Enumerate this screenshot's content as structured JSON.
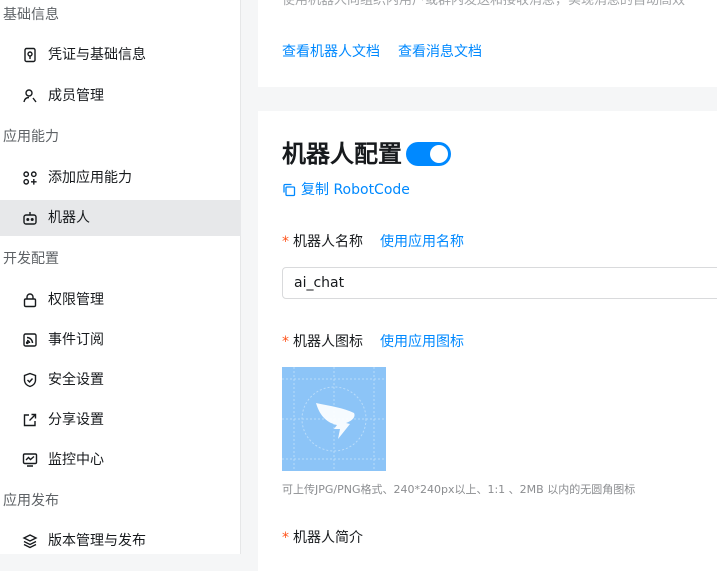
{
  "sidebar": {
    "groups": [
      {
        "title": "基础信息",
        "items": [
          {
            "label": "凭证与基础信息",
            "icon": "credential-icon"
          },
          {
            "label": "成员管理",
            "icon": "user-icon"
          }
        ]
      },
      {
        "title": "应用能力",
        "items": [
          {
            "label": "添加应用能力",
            "icon": "add-capability-icon"
          },
          {
            "label": "机器人",
            "icon": "robot-icon",
            "active": true
          }
        ]
      },
      {
        "title": "开发配置",
        "items": [
          {
            "label": "权限管理",
            "icon": "lock-icon"
          },
          {
            "label": "事件订阅",
            "icon": "subscription-icon"
          },
          {
            "label": "安全设置",
            "icon": "shield-icon"
          },
          {
            "label": "分享设置",
            "icon": "share-icon"
          },
          {
            "label": "监控中心",
            "icon": "monitor-icon"
          }
        ]
      },
      {
        "title": "应用发布",
        "items": [
          {
            "label": "版本管理与发布",
            "icon": "layers-icon"
          }
        ]
      }
    ]
  },
  "top_card": {
    "clipped_description": "使用机器人向组织内用户或群内发送和接收消息，实现消息的自动高效",
    "links": [
      "查看机器人文档",
      "查看消息文档"
    ]
  },
  "robot_config": {
    "title": "机器人配置",
    "enabled": true,
    "copy_label": "复制 RobotCode",
    "name_field": {
      "required_mark": "*",
      "label": "机器人名称",
      "action": "使用应用名称",
      "value": "ai_chat"
    },
    "icon_field": {
      "required_mark": "*",
      "label": "机器人图标",
      "action": "使用应用图标",
      "hint": "可上传JPG/PNG格式、240*240px以上、1:1 、2MB 以内的无圆角图标"
    },
    "intro_field": {
      "required_mark": "*",
      "label": "机器人简介"
    }
  },
  "colors": {
    "accent": "#0089ff",
    "required": "#ff5219",
    "active_nav_bg": "#e7e8ea",
    "page_bg": "#f5f6f7"
  }
}
